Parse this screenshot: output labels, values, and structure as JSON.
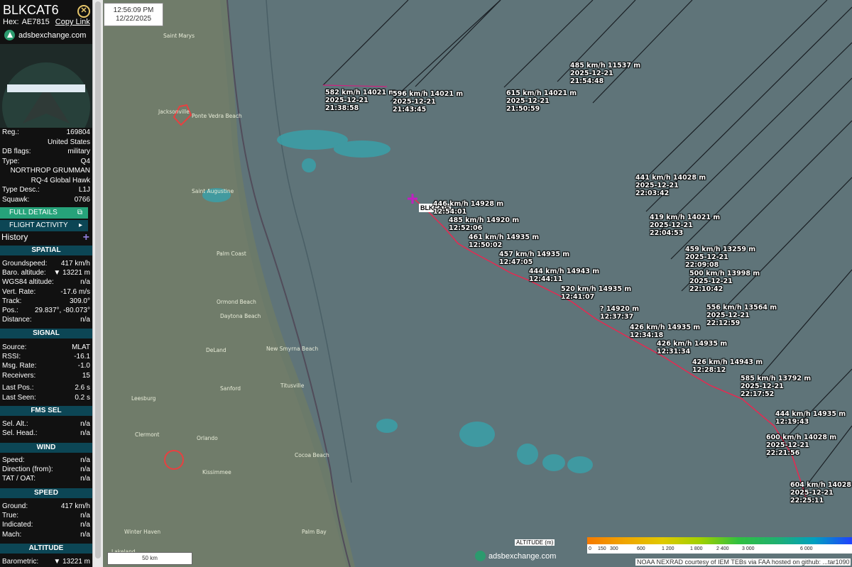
{
  "aircraft": {
    "callsign": "BLKCAT6",
    "hex_label": "Hex:",
    "hex": "AE7815",
    "copy_link": "Copy Link",
    "brand": "adsbexchange.com"
  },
  "details": [
    {
      "k": "Reg.:",
      "v": "169804"
    },
    {
      "k": "",
      "v": "United States"
    },
    {
      "k": "DB flags:",
      "v": "military"
    },
    {
      "k": "Type:",
      "v": "Q4"
    },
    {
      "k": "",
      "v": "NORTHROP GRUMMAN"
    },
    {
      "k": "",
      "v": "RQ-4 Global Hawk"
    },
    {
      "k": "Type Desc.:",
      "v": "L1J"
    },
    {
      "k": "Squawk:",
      "v": "0766"
    }
  ],
  "buttons": {
    "full_details": "FULL DETAILS",
    "flight_activity": "FLIGHT ACTIVITY",
    "history": "History"
  },
  "sections": {
    "spatial": "SPATIAL",
    "signal": "SIGNAL",
    "fms_sel": "FMS SEL",
    "wind": "WIND",
    "speed": "SPEED",
    "altitude": "ALTITUDE"
  },
  "spatial": [
    {
      "k": "Groundspeed:",
      "v": "417 km/h"
    },
    {
      "k": "Baro. altitude:",
      "v": "▼ 13221 m"
    },
    {
      "k": "WGS84 altitude:",
      "v": "n/a"
    },
    {
      "k": "Vert. Rate:",
      "v": "-17.6 m/s"
    },
    {
      "k": "Track:",
      "v": "309.0°"
    },
    {
      "k": "Pos.:",
      "v": "29.837°, -80.073°"
    },
    {
      "k": "Distance:",
      "v": "n/a"
    }
  ],
  "signal": [
    {
      "k": "Source:",
      "v": "MLAT"
    },
    {
      "k": "RSSI:",
      "v": "-16.1"
    },
    {
      "k": "Msg. Rate:",
      "v": "-1.0"
    },
    {
      "k": "Receivers:",
      "v": "15"
    },
    {
      "k": "Last Pos.:",
      "v": "2.6 s"
    },
    {
      "k": "Last Seen:",
      "v": "0.2 s"
    }
  ],
  "fms": [
    {
      "k": "Sel. Alt.:",
      "v": "n/a"
    },
    {
      "k": "Sel. Head.:",
      "v": "n/a"
    }
  ],
  "wind": [
    {
      "k": "Speed:",
      "v": "n/a"
    },
    {
      "k": "Direction (from):",
      "v": "n/a"
    },
    {
      "k": "TAT / OAT:",
      "v": "n/a"
    }
  ],
  "speed": [
    {
      "k": "Ground:",
      "v": "417 km/h"
    },
    {
      "k": "True:",
      "v": "n/a"
    },
    {
      "k": "Indicated:",
      "v": "n/a"
    },
    {
      "k": "Mach:",
      "v": "n/a"
    }
  ],
  "altitude": [
    {
      "k": "Barometric:",
      "v": "▼ 13221 m"
    }
  ],
  "map": {
    "time": "12:56:09 PM",
    "date": "12/22/2025",
    "plane_label": "BLKCAT6",
    "watermark": "adsbexchange.com",
    "scale": "50 km",
    "legend_title": "ALTITUDE (m)",
    "legend_ticks": [
      "0",
      "150",
      "300",
      "600",
      "1 200",
      "1 800",
      "2 400",
      "3 000",
      "6 000"
    ],
    "attribution": "NOAA NEXRAD courtesy of IEM TEBs via FAA hosted on github: ...tar1090",
    "places": [
      "Saint Marys",
      "Jacksonville",
      "Ponte Vedra Beach",
      "Saint Augustine",
      "Palm Coast",
      "Ormond Beach",
      "Daytona Beach",
      "New Smyrna Beach",
      "DeLand",
      "Sanford",
      "Titusville",
      "Orlando",
      "Kissimmee",
      "Leesburg",
      "Clermont",
      "Cocoa Beach",
      "Palm Bay",
      "Winter Haven",
      "Lakeland"
    ],
    "track_labels": [
      {
        "l1": "446 km/h  14928 m",
        "l2": "12:54:01",
        "l3": ""
      },
      {
        "l1": "485 km/h  14920 m",
        "l2": "12:52:06",
        "l3": ""
      },
      {
        "l1": "461 km/h  14935 m",
        "l2": "12:50:02",
        "l3": ""
      },
      {
        "l1": "457 km/h  14935 m",
        "l2": "12:47:05",
        "l3": ""
      },
      {
        "l1": "444 km/h  14943 m",
        "l2": "12:44:11",
        "l3": ""
      },
      {
        "l1": "520 km/h  14935 m",
        "l2": "12:41:07",
        "l3": ""
      },
      {
        "l1": "?  14920 m",
        "l2": "12:37:37",
        "l3": ""
      },
      {
        "l1": "426 km/h  14935 m",
        "l2": "12:34:18",
        "l3": ""
      },
      {
        "l1": "426 km/h  14935 m",
        "l2": "12:31:34",
        "l3": ""
      },
      {
        "l1": "426 km/h  14943 m",
        "l2": "12:28:12",
        "l3": ""
      },
      {
        "l1": "444 km/h  14935 m",
        "l2": "12:19:43",
        "l3": ""
      },
      {
        "l1": "582 km/h  14021 m",
        "l2": "2025-12-21",
        "l3": "21:38:58"
      },
      {
        "l1": "596 km/h  14021 m",
        "l2": "2025-12-21",
        "l3": "21:43:45"
      },
      {
        "l1": "615 km/h  14021 m",
        "l2": "2025-12-21",
        "l3": "21:50:59"
      },
      {
        "l1": "485 km/h  11537 m",
        "l2": "2025-12-21",
        "l3": "21:54:48"
      },
      {
        "l1": "441 km/h  14028 m",
        "l2": "2025-12-21",
        "l3": "22:03:42"
      },
      {
        "l1": "419 km/h  14021 m",
        "l2": "2025-12-21",
        "l3": "22:04:53"
      },
      {
        "l1": "459 km/h  13259 m",
        "l2": "2025-12-21",
        "l3": "22:09:08"
      },
      {
        "l1": "500 km/h  13998 m",
        "l2": "2025-12-21",
        "l3": "22:10:42"
      },
      {
        "l1": "556 km/h  13564 m",
        "l2": "2025-12-21",
        "l3": "22:12:59"
      },
      {
        "l1": "585 km/h  13792 m",
        "l2": "2025-12-21",
        "l3": "22:17:52"
      },
      {
        "l1": "600 km/h  14028 m",
        "l2": "2025-12-21",
        "l3": "22:21:56"
      },
      {
        "l1": "604 km/h  14028 m",
        "l2": "2025-12-21",
        "l3": "22:25:11"
      }
    ]
  }
}
